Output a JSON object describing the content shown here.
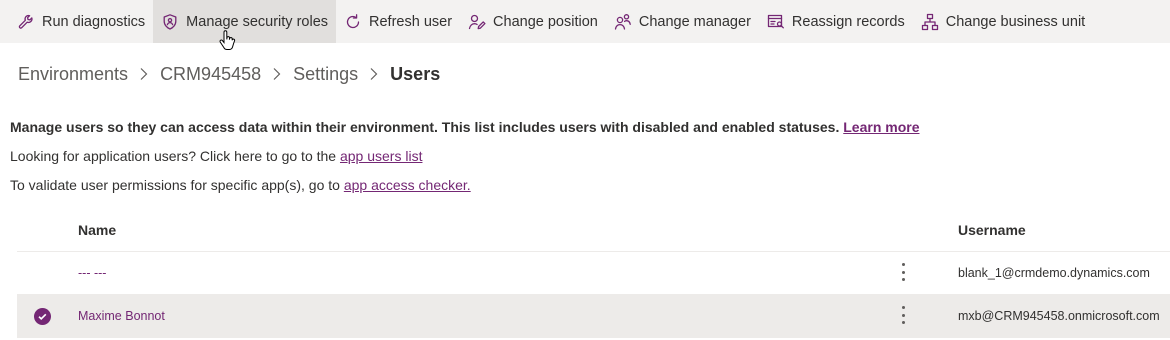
{
  "toolbar": {
    "items": [
      {
        "label": "Run diagnostics",
        "icon": "wrench-icon"
      },
      {
        "label": "Manage security roles",
        "icon": "shield-person-icon",
        "active": true
      },
      {
        "label": "Refresh user",
        "icon": "refresh-icon"
      },
      {
        "label": "Change position",
        "icon": "person-edit-icon"
      },
      {
        "label": "Change manager",
        "icon": "people-icon"
      },
      {
        "label": "Reassign records",
        "icon": "records-reassign-icon"
      },
      {
        "label": "Change business unit",
        "icon": "org-chart-icon"
      }
    ]
  },
  "breadcrumb": {
    "items": [
      "Environments",
      "CRM945458",
      "Settings"
    ],
    "current": "Users"
  },
  "info": {
    "line1_text": "Manage users so they can access data within their environment. This list includes users with disabled and enabled statuses.",
    "line1_link": "Learn more",
    "line2_text": "Looking for application users? Click here to go to the",
    "line2_link": "app users list",
    "line3_text": "To validate user permissions for specific app(s), go to",
    "line3_link": "app access checker."
  },
  "table": {
    "columns": {
      "name": "Name",
      "username": "Username"
    },
    "rows": [
      {
        "name": "--- ---",
        "username": "blank_1@crmdemo.dynamics.com",
        "selected": false
      },
      {
        "name": "Maxime Bonnot",
        "username": "mxb@CRM945458.onmicrosoft.com",
        "selected": true
      }
    ]
  },
  "colors": {
    "accent": "#742774",
    "toolbar_bg": "#f3f2f1",
    "selected_row_bg": "#edebe9"
  }
}
